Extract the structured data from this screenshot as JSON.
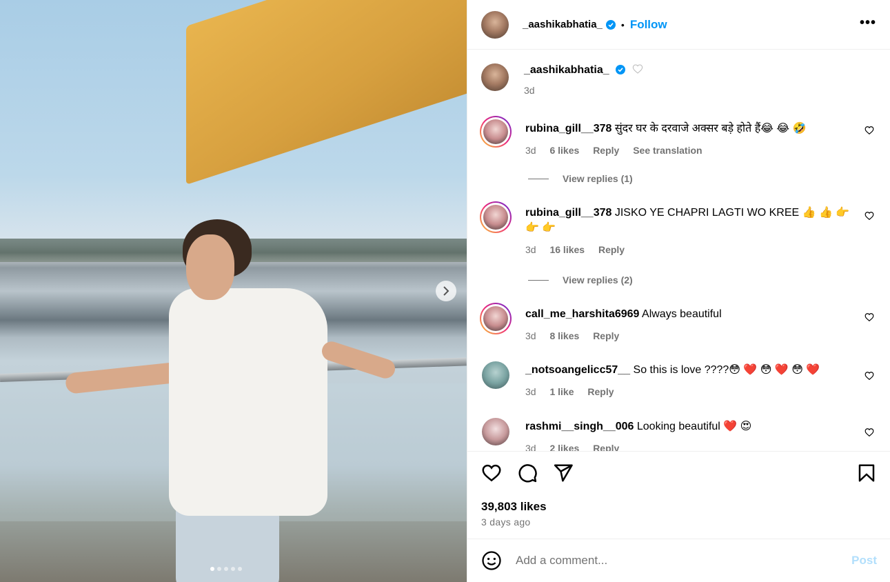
{
  "post": {
    "image_alt": "",
    "carousel_count": 5,
    "carousel_active_index": 0
  },
  "header": {
    "username": "_aashikabhatia_",
    "separator": "•",
    "follow_label": "Follow",
    "more_label": "•••"
  },
  "caption": {
    "username": "_aashikabhatia_",
    "age": "3d"
  },
  "comments": [
    {
      "username": "rubina_gill__378",
      "text": "सुंदर घर के दरवाजे अक्सर बड़े होते हैं😂 😂 🤣",
      "age": "3d",
      "likes": "6 likes",
      "reply_label": "Reply",
      "translate_label": "See translation",
      "view_replies": "View replies (1)"
    },
    {
      "username": "rubina_gill__378",
      "text": "JISKO YE CHAPRI LAGTI WO KREE 👍 👍 👉 👉 👉",
      "age": "3d",
      "likes": "16 likes",
      "reply_label": "Reply",
      "view_replies": "View replies (2)"
    },
    {
      "username": "call_me_harshita6969",
      "text": "Always beautiful",
      "age": "3d",
      "likes": "8 likes",
      "reply_label": "Reply"
    },
    {
      "username": "_notsoangelicc57__",
      "text": "So this is love ????😳 ❤️ 😳 ❤️ 😳 ❤️",
      "age": "3d",
      "likes": "1 like",
      "reply_label": "Reply"
    },
    {
      "username": "rashmi__singh__006",
      "text": "Looking beautiful ❤️ 😍",
      "age": "3d",
      "likes": "2 likes",
      "reply_label": "Reply"
    }
  ],
  "actions": {
    "likes_count": "39,803 likes",
    "posted": "3 days ago"
  },
  "add_comment": {
    "placeholder": "Add a comment...",
    "post_label": "Post"
  },
  "colors": {
    "accent": "#0095f6",
    "muted": "#737373",
    "post_disabled": "#b2dffc"
  }
}
